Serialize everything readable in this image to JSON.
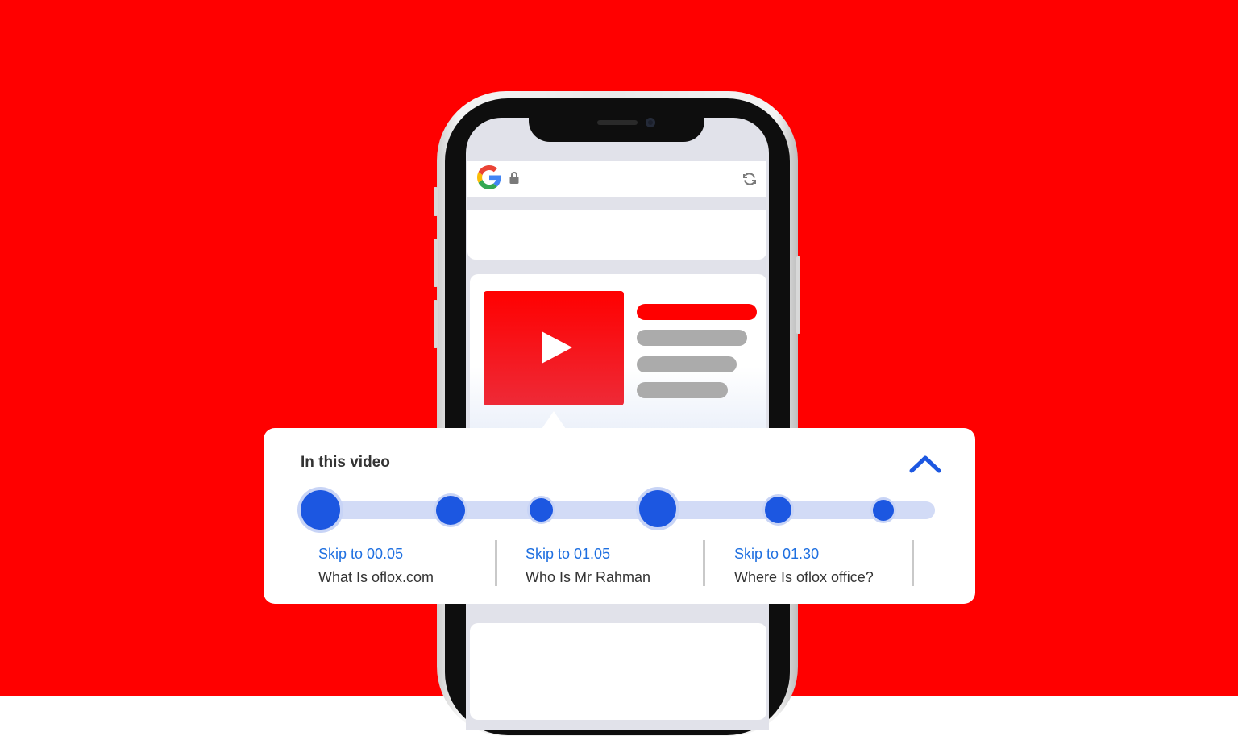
{
  "colors": {
    "background": "#ff0000",
    "accent_blue": "#1c57e1",
    "link_blue": "#1e6fe0",
    "track": "#d2dbf6",
    "placeholder_gray": "#ababab"
  },
  "browser": {
    "search_engine_icon": "google-g-icon",
    "secure_icon": "lock-icon",
    "refresh_icon": "refresh-icon"
  },
  "video_card": {
    "play_icon": "play-icon"
  },
  "chapters_panel": {
    "title": "In this video",
    "toggle_icon": "chevron-up-icon",
    "timeline_marker_count": 6,
    "chapters": [
      {
        "skip_label": "Skip to 00.05",
        "title": "What Is oflox.com"
      },
      {
        "skip_label": "Skip to 01.05",
        "title": "Who Is Mr Rahman"
      },
      {
        "skip_label": "Skip to 01.30",
        "title": "Where Is oflox office?"
      }
    ]
  }
}
